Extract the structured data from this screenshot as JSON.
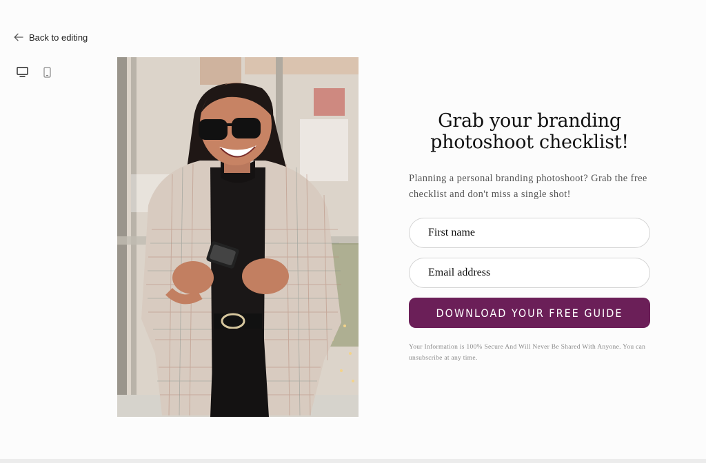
{
  "editor": {
    "back_label": "Back to editing",
    "back_icon": "arrow-left-icon",
    "device_buttons": [
      "desktop-icon",
      "mobile-icon"
    ]
  },
  "optin": {
    "image_alt": "Smiling woman in sunglasses and plaid blazer holding a phone",
    "title": "Grab your branding photoshoot checklist!",
    "description": "Planning a personal branding photoshoot? Grab the free checklist and don't miss a single shot!",
    "first_name_placeholder": "First name",
    "email_placeholder": "Email address",
    "button_label": "DOWNLOAD YOUR FREE GUIDE",
    "disclaimer": "Your Information is 100% Secure And Will Never Be Shared With Anyone. You can unsubscribe at any time.",
    "button_color": "#6b1f58"
  }
}
